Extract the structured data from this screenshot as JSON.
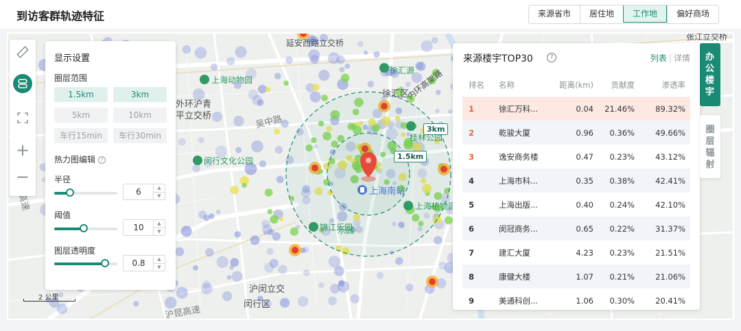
{
  "header": {
    "title": "到访客群轨迹特征",
    "segments": [
      "来源省市",
      "居住地",
      "工作地",
      "偏好商场"
    ],
    "active_segment": "工作地"
  },
  "map": {
    "labels": [
      {
        "text": "延安西路立交桥",
        "style": "m-dark"
      },
      {
        "text": "上海动物园",
        "style": "m-green"
      },
      {
        "text": "徐汇源",
        "style": "m-green"
      },
      {
        "text": "徐汇区",
        "style": "m-dark"
      },
      {
        "text": "外环沪青",
        "style": "m-dark"
      },
      {
        "text": "平立交桥",
        "style": "m-dark"
      },
      {
        "text": "内环高架路",
        "style": "m-dark"
      },
      {
        "text": "吴中路",
        "style": "m-road"
      },
      {
        "text": "桂林公园",
        "style": "m-green"
      },
      {
        "text": "闵行文化公园",
        "style": "m-green"
      },
      {
        "text": "上海南站",
        "style": "m-blue"
      },
      {
        "text": "上海植物园",
        "style": "m-green"
      },
      {
        "text": "锦江乐园",
        "style": "m-green"
      },
      {
        "text": "沪闵立交",
        "style": "m-dark"
      },
      {
        "text": "闵行区",
        "style": "m-dark"
      },
      {
        "text": "沪昆高速",
        "style": "m-road"
      },
      {
        "text": "高速",
        "style": "m-road"
      },
      {
        "text": "乐园",
        "style": "m-green"
      },
      {
        "text": "张江立交桥",
        "style": "m-dark"
      }
    ],
    "ring_labels": {
      "inner": "1.5km",
      "outer": "3km"
    },
    "scale": "2 公里",
    "colors": {
      "accent": "#1b8a74",
      "pin": "#e84a3a"
    }
  },
  "tools": {
    "icons": [
      "ruler-icon",
      "layers-icon",
      "fullscreen-icon",
      "zoom-in-icon",
      "zoom-out-icon"
    ],
    "zoom_in": "+",
    "zoom_out": "−"
  },
  "settings": {
    "title": "显示设置",
    "range_label": "圈层范围",
    "ranges": [
      {
        "label": "1.5km",
        "active": true
      },
      {
        "label": "3km",
        "active": true
      },
      {
        "label": "5km",
        "active": false
      },
      {
        "label": "10km",
        "active": false
      },
      {
        "label": "车行15min",
        "active": false
      },
      {
        "label": "车行30min",
        "active": false
      }
    ],
    "heatmap_label": "热力图编辑",
    "help": "?",
    "radius": {
      "label": "半径",
      "value": "6",
      "fraction": 0.25
    },
    "threshold": {
      "label": "阈值",
      "value": "10",
      "fraction": 0.47
    },
    "opacity": {
      "label": "图层透明度",
      "value": "0.8",
      "fraction": 0.8
    }
  },
  "panel": {
    "title": "来源楼宇TOP30",
    "help": "?",
    "view_list": "列表",
    "view_sep": "|",
    "view_detail": "详情",
    "columns": [
      "排名",
      "名称",
      "距离(km)",
      "贡献度",
      "渗透率"
    ],
    "rows": [
      {
        "rank": "1",
        "name": "徐汇万科...",
        "distance": "0.04",
        "contribution": "21.46%",
        "penetration": "89.32%"
      },
      {
        "rank": "2",
        "name": "乾骏大厦",
        "distance": "0.96",
        "contribution": "0.36%",
        "penetration": "49.66%"
      },
      {
        "rank": "3",
        "name": "逸安商务楼",
        "distance": "0.47",
        "contribution": "0.23%",
        "penetration": "43.12%"
      },
      {
        "rank": "4",
        "name": "上海市科...",
        "distance": "0.35",
        "contribution": "0.38%",
        "penetration": "42.41%"
      },
      {
        "rank": "5",
        "name": "上海出版...",
        "distance": "0.40",
        "contribution": "0.24%",
        "penetration": "42.10%"
      },
      {
        "rank": "6",
        "name": "闵冠商务...",
        "distance": "0.65",
        "contribution": "0.22%",
        "penetration": "31.37%"
      },
      {
        "rank": "7",
        "name": "建汇大厦",
        "distance": "4.23",
        "contribution": "0.23%",
        "penetration": "21.51%"
      },
      {
        "rank": "8",
        "name": "康健大楼",
        "distance": "1.07",
        "contribution": "0.21%",
        "penetration": "21.06%"
      },
      {
        "rank": "9",
        "name": "美通科创...",
        "distance": "1.06",
        "contribution": "0.30%",
        "penetration": "20.41%"
      }
    ],
    "top3_rank_color": "#e8643c"
  },
  "side_tabs": [
    {
      "label": "办公楼宇",
      "active": true
    },
    {
      "label": "圈层辐射",
      "active": false
    }
  ]
}
